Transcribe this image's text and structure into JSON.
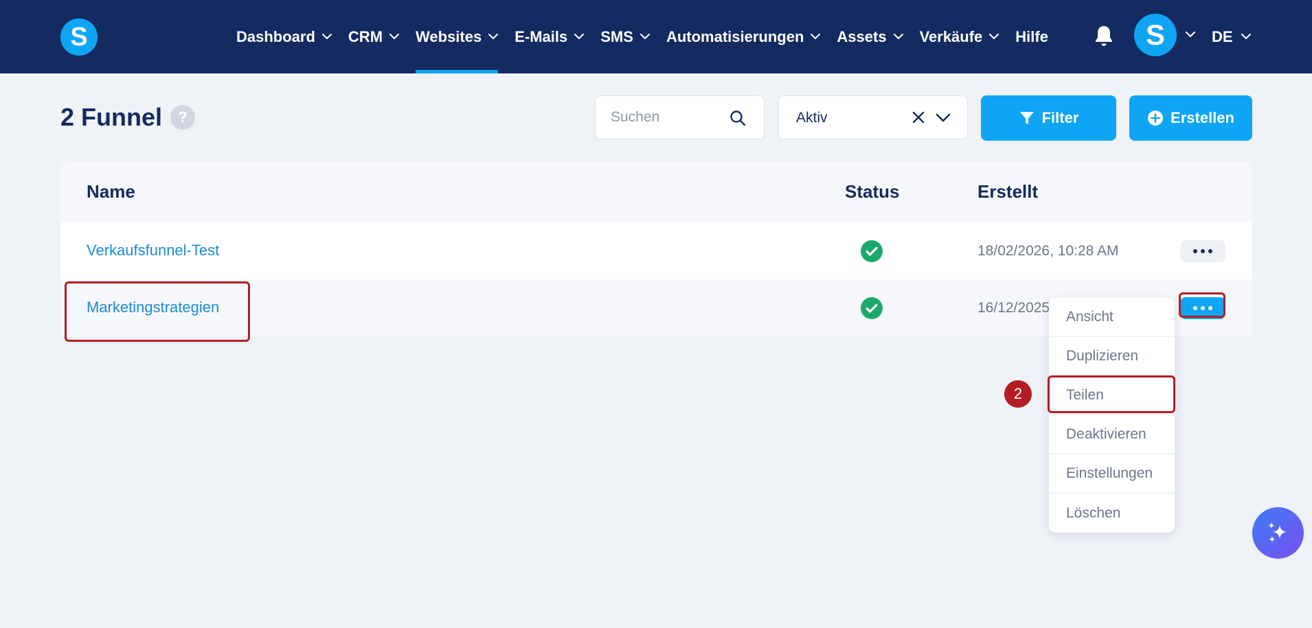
{
  "app": {
    "logo_letter": "S",
    "colors": {
      "navy": "#142b61",
      "accent": "#0ea5f5",
      "highlight": "#b31d24",
      "link": "#1a8bd4",
      "success": "#1aa96b"
    }
  },
  "nav": {
    "items": [
      {
        "label": "Dashboard",
        "has_dropdown": true
      },
      {
        "label": "CRM",
        "has_dropdown": true
      },
      {
        "label": "Websites",
        "has_dropdown": true,
        "active": true
      },
      {
        "label": "E-Mails",
        "has_dropdown": true
      },
      {
        "label": "SMS",
        "has_dropdown": true
      },
      {
        "label": "Automatisierungen",
        "has_dropdown": true
      },
      {
        "label": "Assets",
        "has_dropdown": true
      },
      {
        "label": "Verkäufe",
        "has_dropdown": true
      },
      {
        "label": "Hilfe",
        "has_dropdown": false
      }
    ],
    "bell_icon": "bell-icon",
    "avatar_letter": "S",
    "language": "DE"
  },
  "page": {
    "title": "2 Funnel",
    "help_glyph": "?"
  },
  "toolbar": {
    "search_placeholder": "Suchen",
    "status_filter_value": "Aktiv",
    "filter_label": "Filter",
    "create_label": "Erstellen"
  },
  "table": {
    "columns": [
      "Name",
      "Status",
      "Erstellt"
    ],
    "rows": [
      {
        "name": "Verkaufsfunnel-Test",
        "status": "active",
        "created": "18/02/2026, 10:28 AM"
      },
      {
        "name": "Marketingstrategien",
        "status": "active",
        "created": "16/12/2025"
      }
    ]
  },
  "row_menu": {
    "items": [
      "Ansicht",
      "Duplizieren",
      "Teilen",
      "Deaktivieren",
      "Einstellungen",
      "Löschen"
    ]
  },
  "annotation": {
    "step_number": "2"
  }
}
